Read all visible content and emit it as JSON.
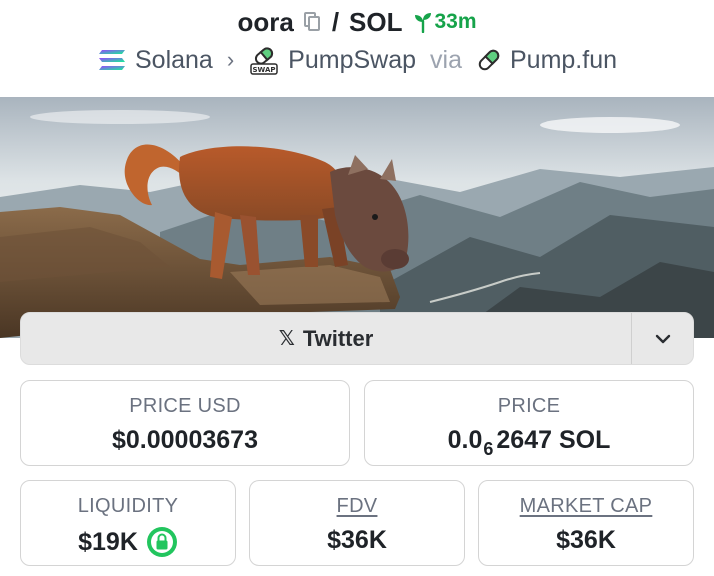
{
  "header": {
    "token_name": "oora",
    "separator": "/",
    "quote_symbol": "SOL",
    "age": "33m"
  },
  "chain_row": {
    "chain": "Solana",
    "dex": "PumpSwap",
    "dex_badge": "SWAP",
    "via_label": "via",
    "launchpad": "Pump.fun"
  },
  "social": {
    "twitter_label": "Twitter",
    "twitter_glyph": "𝕏"
  },
  "stats": {
    "price_usd_label": "PRICE USD",
    "price_usd_value": "$0.00003673",
    "price_label": "PRICE",
    "price_prefix": "0.0",
    "price_zeros": "6",
    "price_digits": "2647 SOL",
    "liquidity_label": "LIQUIDITY",
    "liquidity_value": "$19K",
    "fdv_label": "FDV",
    "fdv_value": "$36K",
    "mcap_label": "MARKET CAP",
    "mcap_value": "$36K"
  },
  "colors": {
    "accent_green": "#16a34a",
    "lock_green": "#22c55e",
    "text_dark": "#1f2328",
    "text_muted": "#6b7280"
  },
  "icons": [
    "copy-icon",
    "sprout-icon",
    "solana-icon",
    "pumpswap-icon",
    "pill-icon",
    "x-icon",
    "chevron-down-icon",
    "lock-icon"
  ]
}
